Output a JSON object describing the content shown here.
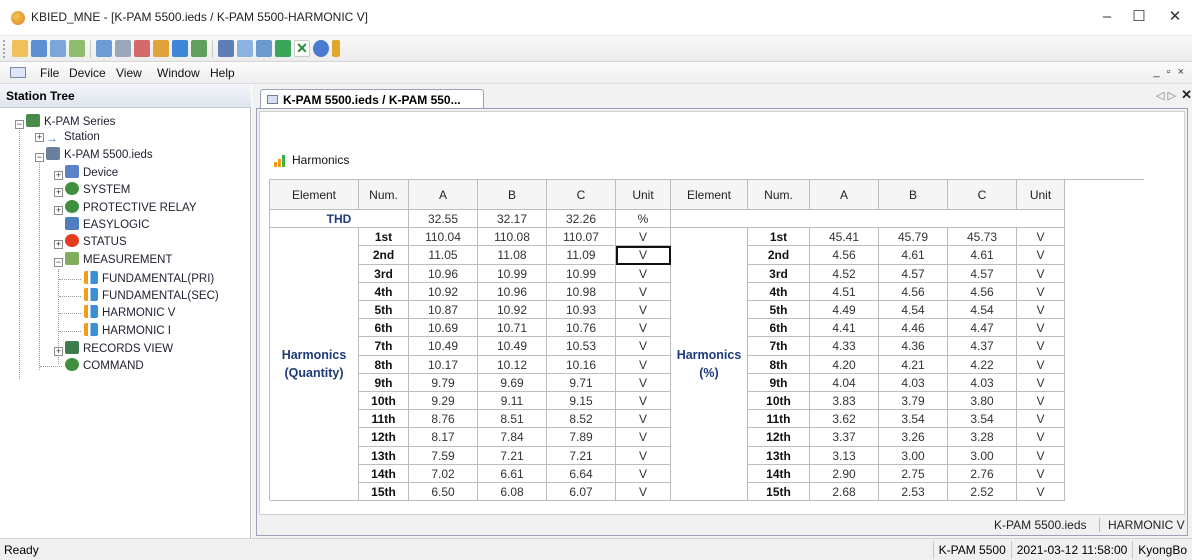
{
  "window": {
    "title": "KBIED_MNE - [K-PAM 5500.ieds / K-PAM 5500-HARMONIC V]",
    "minimize": "–",
    "maximize": "☐",
    "close": "✕"
  },
  "menu": {
    "items": [
      "File",
      "Device",
      "View",
      "Window",
      "Help"
    ],
    "mdi_controls": "_ ▫ ×"
  },
  "tree": {
    "title": "Station Tree",
    "nodes": [
      {
        "label": "K-PAM Series",
        "icon": "series-icon"
      },
      {
        "label": "Station",
        "icon": "arrow-icon"
      },
      {
        "label": "K-PAM 5500.ieds",
        "icon": "ieds-icon"
      },
      {
        "label": "Device",
        "icon": "device-icon"
      },
      {
        "label": "SYSTEM",
        "icon": "system-gear-icon"
      },
      {
        "label": "PROTECTIVE RELAY",
        "icon": "relay-gear-icon"
      },
      {
        "label": "EASYLOGIC",
        "icon": "easylogic-icon"
      },
      {
        "label": "STATUS",
        "icon": "status-red-icon"
      },
      {
        "label": "MEASUREMENT",
        "icon": "measurement-table-icon"
      },
      {
        "label": "FUNDAMENTAL(PRI)",
        "icon": "bar-chart-icon"
      },
      {
        "label": "FUNDAMENTAL(SEC)",
        "icon": "bar-chart-icon"
      },
      {
        "label": "HARMONIC V",
        "icon": "bar-chart-icon"
      },
      {
        "label": "HARMONIC I",
        "icon": "bar-chart-icon"
      },
      {
        "label": "RECORDS VIEW",
        "icon": "records-icon"
      },
      {
        "label": "COMMAND",
        "icon": "command-gear-icon"
      }
    ]
  },
  "document": {
    "tab_label": "K-PAM 5500.ieds / K-PAM 550...",
    "tab_nav": "◁ ▷",
    "tab_close": "✕",
    "section_title": "Harmonics",
    "status_left": "K-PAM 5500.ieds",
    "status_right": "HARMONIC V"
  },
  "table": {
    "headers": [
      "Element",
      "Num.",
      "A",
      "B",
      "C",
      "Unit",
      "Element",
      "Num.",
      "A",
      "B",
      "C",
      "Unit"
    ],
    "thd": {
      "label": "THD",
      "a": "32.55",
      "b": "32.17",
      "c": "32.26",
      "unit": "%"
    },
    "left_group_label": "Harmonics\n(Quantity)",
    "right_group_label": "Harmonics\n(%)",
    "rows": [
      {
        "num": "1st",
        "a": "110.04",
        "b": "110.08",
        "c": "110.07",
        "unit": "V",
        "pa": "45.41",
        "pb": "45.79",
        "pc": "45.73",
        "punit": "V"
      },
      {
        "num": "2nd",
        "a": "11.05",
        "b": "11.08",
        "c": "11.09",
        "unit": "V",
        "pa": "4.56",
        "pb": "4.61",
        "pc": "4.61",
        "punit": "V"
      },
      {
        "num": "3rd",
        "a": "10.96",
        "b": "10.99",
        "c": "10.99",
        "unit": "V",
        "pa": "4.52",
        "pb": "4.57",
        "pc": "4.57",
        "punit": "V"
      },
      {
        "num": "4th",
        "a": "10.92",
        "b": "10.96",
        "c": "10.98",
        "unit": "V",
        "pa": "4.51",
        "pb": "4.56",
        "pc": "4.56",
        "punit": "V"
      },
      {
        "num": "5th",
        "a": "10.87",
        "b": "10.92",
        "c": "10.93",
        "unit": "V",
        "pa": "4.49",
        "pb": "4.54",
        "pc": "4.54",
        "punit": "V"
      },
      {
        "num": "6th",
        "a": "10.69",
        "b": "10.71",
        "c": "10.76",
        "unit": "V",
        "pa": "4.41",
        "pb": "4.46",
        "pc": "4.47",
        "punit": "V"
      },
      {
        "num": "7th",
        "a": "10.49",
        "b": "10.49",
        "c": "10.53",
        "unit": "V",
        "pa": "4.33",
        "pb": "4.36",
        "pc": "4.37",
        "punit": "V"
      },
      {
        "num": "8th",
        "a": "10.17",
        "b": "10.12",
        "c": "10.16",
        "unit": "V",
        "pa": "4.20",
        "pb": "4.21",
        "pc": "4.22",
        "punit": "V"
      },
      {
        "num": "9th",
        "a": "9.79",
        "b": "9.69",
        "c": "9.71",
        "unit": "V",
        "pa": "4.04",
        "pb": "4.03",
        "pc": "4.03",
        "punit": "V"
      },
      {
        "num": "10th",
        "a": "9.29",
        "b": "9.11",
        "c": "9.15",
        "unit": "V",
        "pa": "3.83",
        "pb": "3.79",
        "pc": "3.80",
        "punit": "V"
      },
      {
        "num": "11th",
        "a": "8.76",
        "b": "8.51",
        "c": "8.52",
        "unit": "V",
        "pa": "3.62",
        "pb": "3.54",
        "pc": "3.54",
        "punit": "V"
      },
      {
        "num": "12th",
        "a": "8.17",
        "b": "7.84",
        "c": "7.89",
        "unit": "V",
        "pa": "3.37",
        "pb": "3.26",
        "pc": "3.28",
        "punit": "V"
      },
      {
        "num": "13th",
        "a": "7.59",
        "b": "7.21",
        "c": "7.21",
        "unit": "V",
        "pa": "3.13",
        "pb": "3.00",
        "pc": "3.00",
        "punit": "V"
      },
      {
        "num": "14th",
        "a": "7.02",
        "b": "6.61",
        "c": "6.64",
        "unit": "V",
        "pa": "2.90",
        "pb": "2.75",
        "pc": "2.76",
        "punit": "V"
      },
      {
        "num": "15th",
        "a": "6.50",
        "b": "6.08",
        "c": "6.07",
        "unit": "V",
        "pa": "2.68",
        "pb": "2.53",
        "pc": "2.52",
        "punit": "V"
      }
    ]
  },
  "statusbar": {
    "ready": "Ready",
    "device": "K-PAM 5500",
    "datetime": "2021-03-12 11:58:00",
    "user": "KyongBo"
  },
  "colors": {
    "group_label": "#1d3a7a",
    "chart_icon": "#f39c1a",
    "status_red": "#e33b1c"
  }
}
